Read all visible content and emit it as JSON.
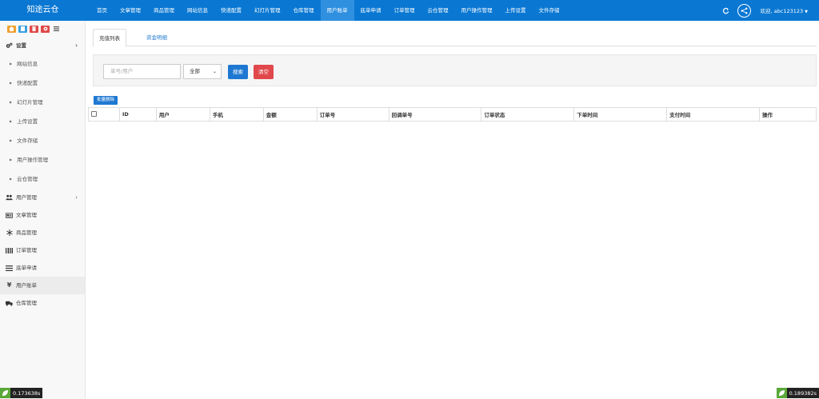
{
  "app": {
    "brand": "知途云仓"
  },
  "nav": {
    "items": [
      "首页",
      "文章管理",
      "商品管理",
      "网站信息",
      "快递配置",
      "幻灯片管理",
      "仓库管理",
      "用户账单",
      "底单申请",
      "订单管理",
      "云仓管理",
      "用户操作管理",
      "上传设置",
      "文件存储"
    ],
    "active_index": 7
  },
  "user": {
    "welcome": "欢迎, abc123123"
  },
  "sidebar": {
    "settings": "设置",
    "sub_items": [
      "网站信息",
      "快递配置",
      "幻灯片管理",
      "上传设置",
      "文件存储",
      "用户操作管理",
      "云仓管理"
    ],
    "user_mgmt": "用户管理",
    "article_mgmt": "文章管理",
    "product_mgmt": "商品管理",
    "order_mgmt": "订单管理",
    "bottom_apply": "底单申请",
    "user_bill": "用户账单",
    "warehouse_mgmt": "仓库管理"
  },
  "tabs": {
    "recharge": "充值列表",
    "funds": "资金明细"
  },
  "filter": {
    "placeholder": "单号/用户",
    "select_value": "全部",
    "search": "搜索",
    "clear": "清空"
  },
  "batch_delete": "批量删除",
  "table": {
    "headers": [
      "ID",
      "用户",
      "手机",
      "金额",
      "订单号",
      "回调单号",
      "订单状态",
      "下单时间",
      "支付时间",
      "操作"
    ]
  },
  "stats": {
    "left": "0.173638s",
    "right": "0.189382s"
  },
  "colors": {
    "primary": "#0a78d3",
    "danger": "#e0484c",
    "sidebar_bg": "#f8f8f8"
  }
}
